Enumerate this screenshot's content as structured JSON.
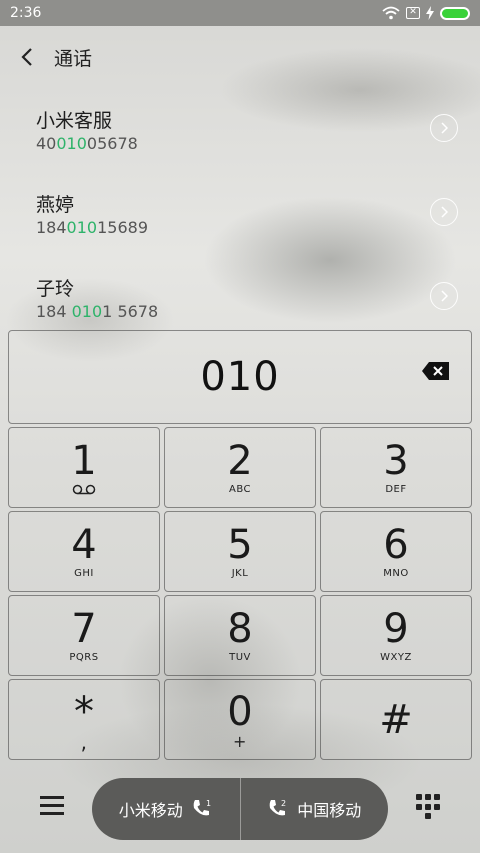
{
  "status": {
    "time": "2:36"
  },
  "header": {
    "title": "通话"
  },
  "contacts": [
    {
      "name": "小米客服",
      "pre": "40",
      "match": "010",
      "post": "05678"
    },
    {
      "name": "燕婷",
      "pre": "184",
      "match": "010",
      "post": "15689"
    },
    {
      "name": "子玲",
      "pre": "184 ",
      "match": "010",
      "post": "1 5678"
    }
  ],
  "dial_display": "010",
  "keys": [
    {
      "digit": "1",
      "sub": ""
    },
    {
      "digit": "2",
      "sub": "ABC"
    },
    {
      "digit": "3",
      "sub": "DEF"
    },
    {
      "digit": "4",
      "sub": "GHI"
    },
    {
      "digit": "5",
      "sub": "JKL"
    },
    {
      "digit": "6",
      "sub": "MNO"
    },
    {
      "digit": "7",
      "sub": "PQRS"
    },
    {
      "digit": "8",
      "sub": "TUV"
    },
    {
      "digit": "9",
      "sub": "WXYZ"
    },
    {
      "digit": "*",
      "sub": ","
    },
    {
      "digit": "0",
      "sub": "+"
    },
    {
      "digit": "#",
      "sub": ""
    }
  ],
  "call_buttons": {
    "sim1_label": "小米移动",
    "sim1_index": "1",
    "sim2_label": "中国移动",
    "sim2_index": "2"
  },
  "colors": {
    "match_highlight": "#2eb36a",
    "battery": "#3ad23a",
    "call_pill": "#5b5b59"
  }
}
